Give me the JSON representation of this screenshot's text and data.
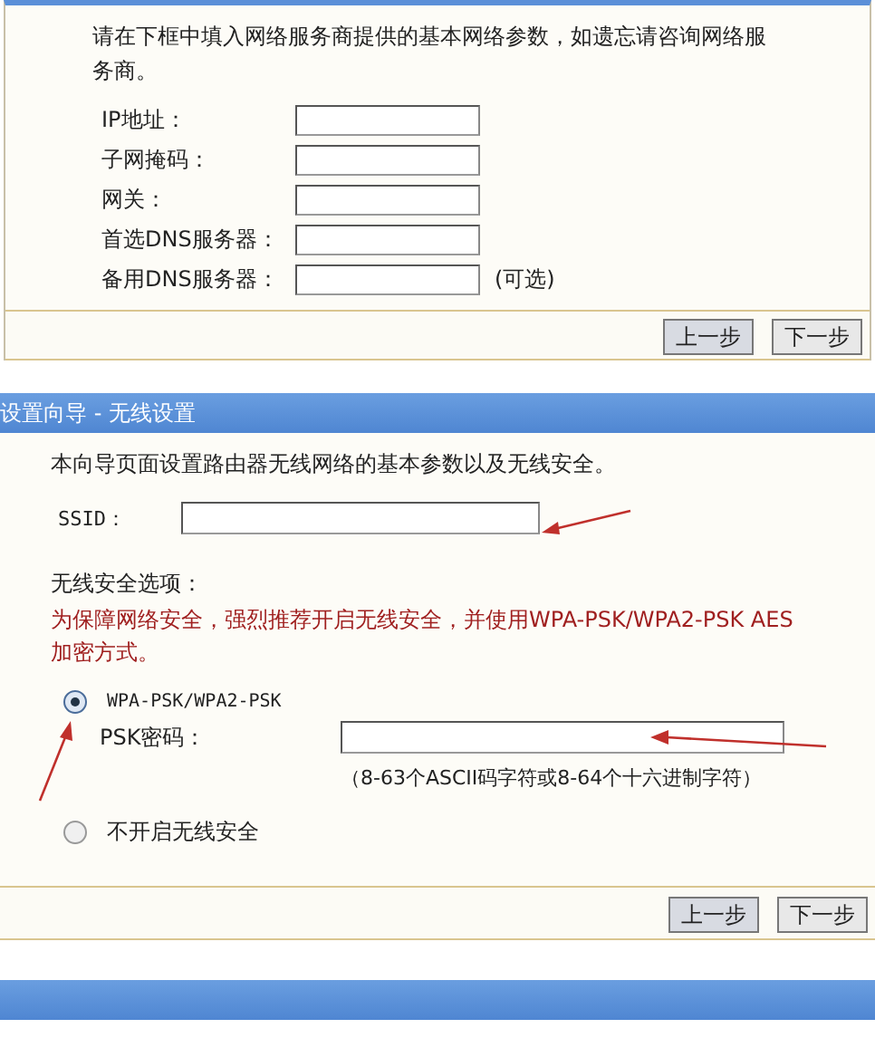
{
  "wan_panel": {
    "intro": "请在下框中填入网络服务商提供的基本网络参数，如遗忘请咨询网络服务商。",
    "fields": [
      {
        "label": "IP地址："
      },
      {
        "label": "子网掩码："
      },
      {
        "label": "网关："
      },
      {
        "label": "首选DNS服务器："
      },
      {
        "label": "备用DNS服务器：",
        "note": "(可选)"
      }
    ],
    "buttons": [
      "上一步",
      "下一步"
    ]
  },
  "wireless_panel": {
    "title": "设置向导 - 无线设置",
    "intro": "本向导页面设置路由器无线网络的基本参数以及无线安全。",
    "ssid_label": "SSID：",
    "security_heading": "无线安全选项：",
    "warning": "为保障网络安全，强烈推荐开启无线安全，并使用WPA-PSK/WPA2-PSK AES加密方式。",
    "options": [
      {
        "label": "WPA-PSK/WPA2-PSK",
        "selected": true,
        "kind": "psk",
        "psk_label": "PSK密码：",
        "psk_hint": "（8-63个ASCII码字符或8-64个十六进制字符）"
      },
      {
        "label": "不开启无线安全",
        "selected": false,
        "kind": "plain"
      }
    ],
    "buttons": [
      "上一步",
      "下一步"
    ]
  },
  "next_panel": {
    "kind": "header"
  }
}
